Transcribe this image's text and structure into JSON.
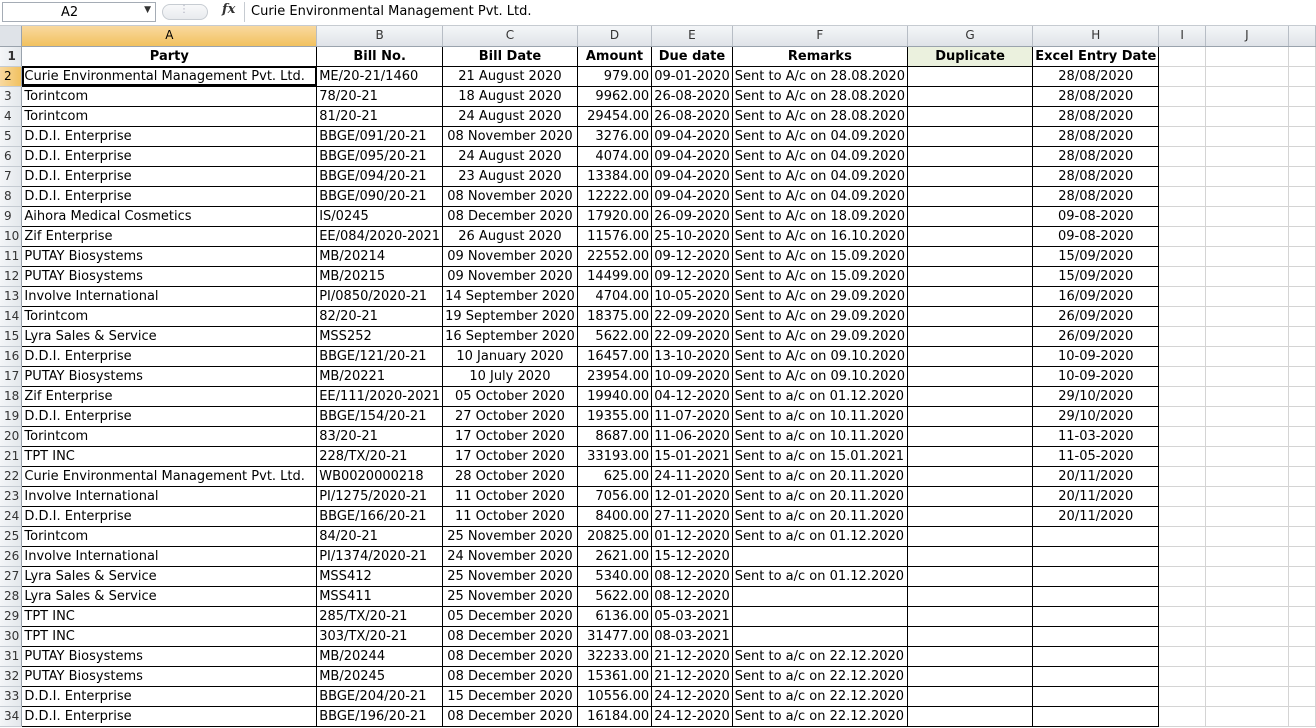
{
  "formula_bar": {
    "name_box": "A2",
    "fx": "fx",
    "value": "Curie Environmental Management Pvt. Ltd."
  },
  "columns": [
    "A",
    "B",
    "C",
    "D",
    "E",
    "F",
    "G",
    "H",
    "I",
    "J"
  ],
  "header_row": {
    "party": "Party",
    "bill_no": "Bill No.",
    "bill_date": "Bill Date",
    "amount": "Amount",
    "due_date": "Due date",
    "remarks": "Remarks",
    "duplicate": "Duplicate",
    "entry_date": "Excel Entry Date"
  },
  "rows": [
    {
      "party": "Curie Environmental Management Pvt. Ltd.",
      "bill_no": "ME/20-21/1460",
      "bill_date": "21 August 2020",
      "amount": "979.00",
      "due_date": "09-01-2020",
      "remarks": "Sent to A/c on 28.08.2020",
      "entry_date": "28/08/2020"
    },
    {
      "party": "Torintcom",
      "bill_no": "78/20-21",
      "bill_date": "18 August 2020",
      "amount": "9962.00",
      "due_date": "26-08-2020",
      "remarks": "Sent to A/c on 28.08.2020",
      "entry_date": "28/08/2020"
    },
    {
      "party": "Torintcom",
      "bill_no": "81/20-21",
      "bill_date": "24 August 2020",
      "amount": "29454.00",
      "due_date": "26-08-2020",
      "remarks": "Sent to A/c on 28.08.2020",
      "entry_date": "28/08/2020"
    },
    {
      "party": "D.D.I. Enterprise",
      "bill_no": "BBGE/091/20-21",
      "bill_date": "08 November 2020",
      "amount": "3276.00",
      "due_date": "09-04-2020",
      "remarks": "Sent to A/c on 04.09.2020",
      "entry_date": "28/08/2020"
    },
    {
      "party": "D.D.I. Enterprise",
      "bill_no": "BBGE/095/20-21",
      "bill_date": "24 August 2020",
      "amount": "4074.00",
      "due_date": "09-04-2020",
      "remarks": "Sent to A/c on 04.09.2020",
      "entry_date": "28/08/2020"
    },
    {
      "party": "D.D.I. Enterprise",
      "bill_no": "BBGE/094/20-21",
      "bill_date": "23 August 2020",
      "amount": "13384.00",
      "due_date": "09-04-2020",
      "remarks": "Sent to A/c on 04.09.2020",
      "entry_date": "28/08/2020"
    },
    {
      "party": "D.D.I. Enterprise",
      "bill_no": "BBGE/090/20-21",
      "bill_date": "08 November 2020",
      "amount": "12222.00",
      "due_date": "09-04-2020",
      "remarks": "Sent to A/c on 04.09.2020",
      "entry_date": "28/08/2020"
    },
    {
      "party": "Aihora Medical Cosmetics",
      "bill_no": "IS/0245",
      "bill_date": "08 December 2020",
      "amount": "17920.00",
      "due_date": "26-09-2020",
      "remarks": "Sent to A/c on 18.09.2020",
      "entry_date": "09-08-2020"
    },
    {
      "party": "Zif Enterprise",
      "bill_no": "EE/084/2020-2021",
      "bill_date": "26 August 2020",
      "amount": "11576.00",
      "due_date": "25-10-2020",
      "remarks": "Sent to A/c on 16.10.2020",
      "entry_date": "09-08-2020"
    },
    {
      "party": "PUTAY Biosystems",
      "bill_no": "MB/20214",
      "bill_date": "09 November 2020",
      "amount": "22552.00",
      "due_date": "09-12-2020",
      "remarks": "Sent to A/c on 15.09.2020",
      "entry_date": "15/09/2020"
    },
    {
      "party": "PUTAY Biosystems",
      "bill_no": "MB/20215",
      "bill_date": "09 November 2020",
      "amount": "14499.00",
      "due_date": "09-12-2020",
      "remarks": "Sent to A/c on 15.09.2020",
      "entry_date": "15/09/2020"
    },
    {
      "party": "Involve International",
      "bill_no": "PI/0850/2020-21",
      "bill_date": "14 September 2020",
      "amount": "4704.00",
      "due_date": "10-05-2020",
      "remarks": "Sent to A/c on 29.09.2020",
      "entry_date": "16/09/2020"
    },
    {
      "party": "Torintcom",
      "bill_no": "82/20-21",
      "bill_date": "19 September 2020",
      "amount": "18375.00",
      "due_date": "22-09-2020",
      "remarks": "Sent to A/c on 29.09.2020",
      "entry_date": "26/09/2020"
    },
    {
      "party": "Lyra Sales & Service",
      "bill_no": "MSS252",
      "bill_date": "16 September 2020",
      "amount": "5622.00",
      "due_date": "22-09-2020",
      "remarks": "Sent to A/c on 29.09.2020",
      "entry_date": "26/09/2020"
    },
    {
      "party": "D.D.I. Enterprise",
      "bill_no": "BBGE/121/20-21",
      "bill_date": "10 January 2020",
      "amount": "16457.00",
      "due_date": "13-10-2020",
      "remarks": "Sent to A/c on 09.10.2020",
      "entry_date": "10-09-2020"
    },
    {
      "party": "PUTAY Biosystems",
      "bill_no": "MB/20221",
      "bill_date": "10 July 2020",
      "amount": "23954.00",
      "due_date": "10-09-2020",
      "remarks": "Sent to A/c on 09.10.2020",
      "entry_date": "10-09-2020"
    },
    {
      "party": "Zif Enterprise",
      "bill_no": "EE/111/2020-2021",
      "bill_date": "05 October 2020",
      "amount": "19940.00",
      "due_date": "04-12-2020",
      "remarks": "Sent to a/c on 01.12.2020",
      "entry_date": "29/10/2020"
    },
    {
      "party": "D.D.I. Enterprise",
      "bill_no": "BBGE/154/20-21",
      "bill_date": "27 October 2020",
      "amount": "19355.00",
      "due_date": "11-07-2020",
      "remarks": "Sent to a/c on 10.11.2020",
      "entry_date": "29/10/2020"
    },
    {
      "party": "Torintcom",
      "bill_no": "83/20-21",
      "bill_date": "17 October 2020",
      "amount": "8687.00",
      "due_date": "11-06-2020",
      "remarks": "Sent to a/c on 10.11.2020",
      "entry_date": "11-03-2020"
    },
    {
      "party": "TPT INC",
      "bill_no": "228/TX/20-21",
      "bill_date": "17 October 2020",
      "amount": "33193.00",
      "due_date": "15-01-2021",
      "remarks": "Sent to a/c on 15.01.2021",
      "entry_date": "11-05-2020"
    },
    {
      "party": "Curie Environmental Management Pvt. Ltd.",
      "bill_no": "WB0020000218",
      "bill_date": "28 October 2020",
      "amount": "625.00",
      "due_date": "24-11-2020",
      "remarks": "Sent to a/c on 20.11.2020",
      "entry_date": "20/11/2020"
    },
    {
      "party": "Involve International",
      "bill_no": "PI/1275/2020-21",
      "bill_date": "11 October 2020",
      "amount": "7056.00",
      "due_date": "12-01-2020",
      "remarks": "Sent to a/c on 20.11.2020",
      "entry_date": "20/11/2020"
    },
    {
      "party": "D.D.I. Enterprise",
      "bill_no": "BBGE/166/20-21",
      "bill_date": "11 October 2020",
      "amount": "8400.00",
      "due_date": "27-11-2020",
      "remarks": "Sent to a/c on 20.11.2020",
      "entry_date": "20/11/2020"
    },
    {
      "party": "Torintcom",
      "bill_no": "84/20-21",
      "bill_date": "25 November 2020",
      "amount": "20825.00",
      "due_date": "01-12-2020",
      "remarks": "Sent to a/c on 01.12.2020",
      "entry_date": ""
    },
    {
      "party": "Involve International",
      "bill_no": "PI/1374/2020-21",
      "bill_date": "24 November 2020",
      "amount": "2621.00",
      "due_date": "15-12-2020",
      "remarks": "",
      "entry_date": ""
    },
    {
      "party": "Lyra Sales & Service",
      "bill_no": "MSS412",
      "bill_date": "25 November 2020",
      "amount": "5340.00",
      "due_date": "08-12-2020",
      "remarks": "Sent to a/c on 01.12.2020",
      "entry_date": ""
    },
    {
      "party": "Lyra Sales & Service",
      "bill_no": "MSS411",
      "bill_date": "25 November 2020",
      "amount": "5622.00",
      "due_date": "08-12-2020",
      "remarks": "",
      "entry_date": ""
    },
    {
      "party": "TPT INC",
      "bill_no": "285/TX/20-21",
      "bill_date": "05 December 2020",
      "amount": "6136.00",
      "due_date": "05-03-2021",
      "remarks": "",
      "entry_date": ""
    },
    {
      "party": "TPT INC",
      "bill_no": "303/TX/20-21",
      "bill_date": "08 December 2020",
      "amount": "31477.00",
      "due_date": "08-03-2021",
      "remarks": "",
      "entry_date": ""
    },
    {
      "party": "PUTAY Biosystems",
      "bill_no": "MB/20244",
      "bill_date": "08 December 2020",
      "amount": "32233.00",
      "due_date": "21-12-2020",
      "remarks": "Sent to a/c on 22.12.2020",
      "entry_date": ""
    },
    {
      "party": "PUTAY Biosystems",
      "bill_no": "MB/20245",
      "bill_date": "08 December 2020",
      "amount": "15361.00",
      "due_date": "21-12-2020",
      "remarks": "Sent to a/c on 22.12.2020",
      "entry_date": ""
    },
    {
      "party": "D.D.I. Enterprise",
      "bill_no": "BBGE/204/20-21",
      "bill_date": "15 December 2020",
      "amount": "10556.00",
      "due_date": "24-12-2020",
      "remarks": "Sent to a/c on 22.12.2020",
      "entry_date": ""
    },
    {
      "party": "D.D.I. Enterprise",
      "bill_no": "BBGE/196/20-21",
      "bill_date": "08 December 2020",
      "amount": "16184.00",
      "due_date": "24-12-2020",
      "remarks": "Sent to a/c on 22.12.2020",
      "entry_date": ""
    }
  ],
  "colors": {
    "duplicate_header_bg": "#ebf1de",
    "selected_header": "#f1c15f"
  }
}
